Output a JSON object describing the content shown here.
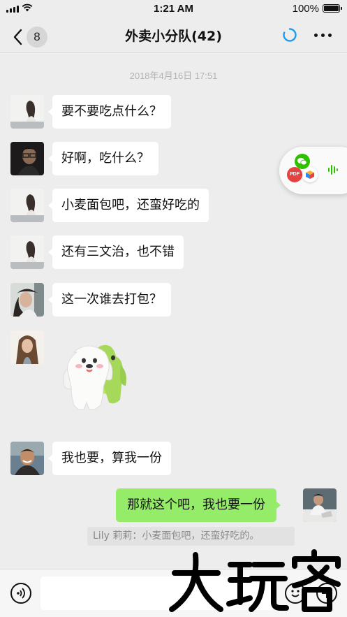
{
  "status_bar": {
    "time": "1:21 AM",
    "battery": "100%"
  },
  "nav": {
    "unread_count": "8",
    "title": "外卖小分队(42)"
  },
  "chat": {
    "timestamp": "2018年4月16日 17:51",
    "messages": [
      {
        "side": "left",
        "avatar": "woman-profile-avatar",
        "text": "要不要吃点什么？"
      },
      {
        "side": "left",
        "avatar": "man-glasses-avatar",
        "text": "好啊，吃什么？"
      },
      {
        "side": "left",
        "avatar": "woman-profile-avatar",
        "text": "小麦面包吧，还蛮好吃的"
      },
      {
        "side": "left",
        "avatar": "woman-profile-avatar",
        "text": "还有三文治，也不错"
      },
      {
        "side": "left",
        "avatar": "woman-hat-avatar",
        "text": "这一次谁去打包？"
      },
      {
        "side": "left",
        "avatar": "woman-longhair-avatar",
        "sticker": "two-puppies-hugging-sticker"
      },
      {
        "side": "left",
        "avatar": "man-smiling-avatar",
        "text": "我也要，算我一份"
      },
      {
        "side": "right",
        "avatar": "man-laptop-avatar",
        "text": "那就这个吧，我也要一份"
      }
    ],
    "quote": "Lily 莉莉：小麦面包吧，还蛮好吃的。"
  },
  "floating_panel": {
    "icons": [
      "wechat-icon",
      "pdf-icon",
      "package-icon",
      "voice-wave-icon"
    ],
    "pdf_label": "PDF"
  },
  "input_bar": {
    "placeholder": "",
    "icons": [
      "voice-icon",
      "emoji-icon",
      "plus-icon"
    ]
  },
  "watermark": {
    "text": "大玩客"
  },
  "colors": {
    "background": "#ededed",
    "incoming_bubble": "#ffffff",
    "outgoing_bubble": "#95ec69",
    "wechat_green": "#2dc100",
    "loading_blue": "#1e9bf0"
  }
}
